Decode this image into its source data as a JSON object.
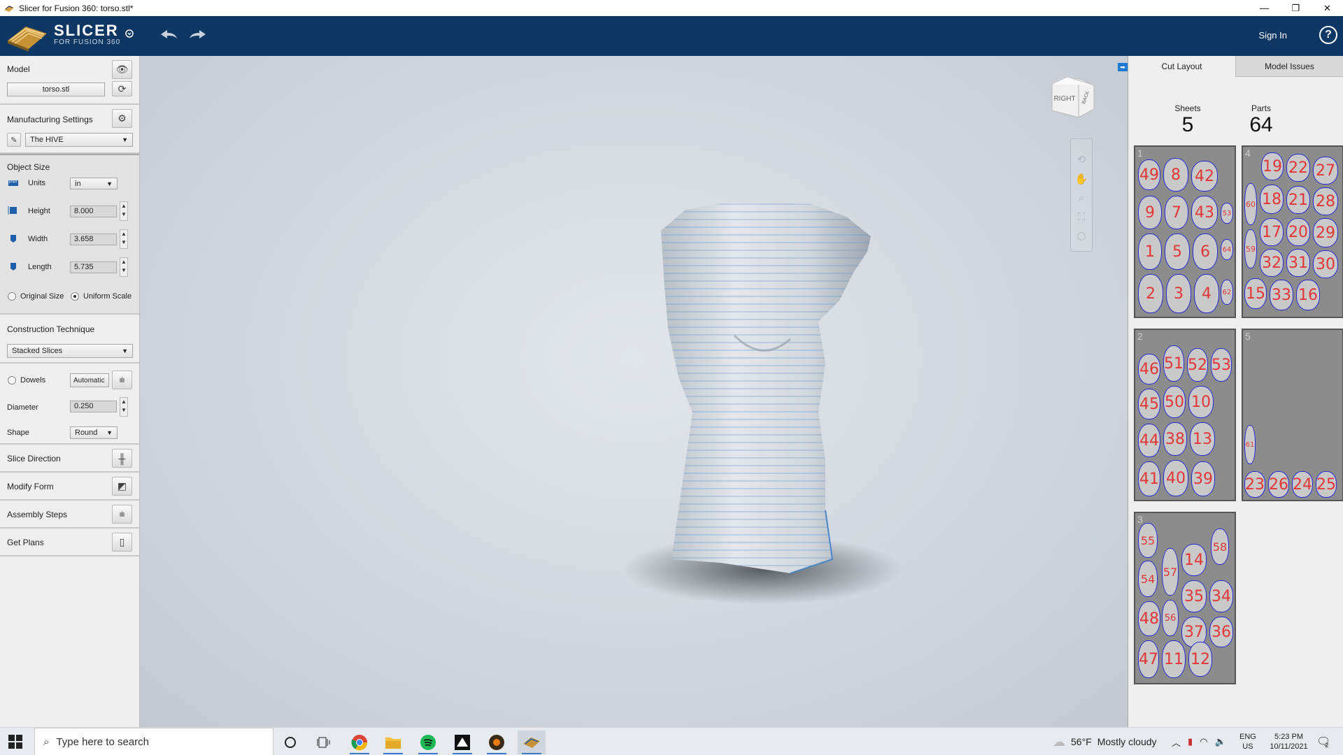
{
  "window": {
    "title": "Slicer for Fusion 360: torso.stl*",
    "minimize": "—",
    "restore": "❐",
    "close": "✕"
  },
  "header": {
    "logo_main": "SLICER",
    "logo_sub": "FOR FUSION 360",
    "sign_in": "Sign In",
    "help": "?"
  },
  "left": {
    "model_label": "Model",
    "model_file": "torso.stl",
    "mfg_label": "Manufacturing Settings",
    "mfg_value": "The HIVE",
    "object_size_label": "Object Size",
    "units_label": "Units",
    "units_value": "in",
    "height_label": "Height",
    "height_value": "8.000",
    "width_label": "Width",
    "width_value": "3.658",
    "length_label": "Length",
    "length_value": "5.735",
    "original_size": "Original Size",
    "uniform_scale": "Uniform Scale",
    "construction_label": "Construction Technique",
    "construction_value": "Stacked Slices",
    "dowels_label": "Dowels",
    "dowels_mode": "Automatic",
    "diameter_label": "Diameter",
    "diameter_value": "0.250",
    "shape_label": "Shape",
    "shape_value": "Round",
    "slice_direction": "Slice Direction",
    "modify_form": "Modify Form",
    "assembly_steps": "Assembly Steps",
    "get_plans": "Get Plans"
  },
  "viewcube": {
    "face_front": "RIGHT",
    "face_side": "BACK"
  },
  "right": {
    "tab_cut_layout": "Cut Layout",
    "tab_model_issues": "Model Issues",
    "sheets_label": "Sheets",
    "sheets_value": "5",
    "parts_label": "Parts",
    "parts_value": "64",
    "sheets": [
      {
        "id": "1",
        "parts": [
          "49",
          "8",
          "42",
          "9",
          "7",
          "43",
          "53",
          "1",
          "5",
          "6",
          "64",
          "2",
          "3",
          "4",
          "62"
        ]
      },
      {
        "id": "4",
        "parts": [
          "19",
          "22",
          "27",
          "60",
          "18",
          "21",
          "28",
          "17",
          "20",
          "29",
          "59",
          "32",
          "31",
          "30",
          "15",
          "33",
          "16"
        ]
      },
      {
        "id": "2",
        "parts": [
          "46",
          "51",
          "52",
          "53",
          "45",
          "50",
          "10",
          "44",
          "38",
          "13",
          "41",
          "40",
          "39"
        ]
      },
      {
        "id": "5",
        "parts": [
          "61",
          "23",
          "26",
          "24",
          "25"
        ]
      },
      {
        "id": "3",
        "parts": [
          "55",
          "58",
          "57",
          "14",
          "54",
          "35",
          "34",
          "48",
          "56",
          "37",
          "36",
          "47",
          "11",
          "12"
        ]
      }
    ]
  },
  "taskbar": {
    "search_placeholder": "Type here to search",
    "weather_temp": "56°F",
    "weather_desc": "Mostly cloudy",
    "lang": "ENG",
    "region": "US",
    "time": "5:23 PM",
    "date": "10/11/2021",
    "notifications": "2"
  }
}
